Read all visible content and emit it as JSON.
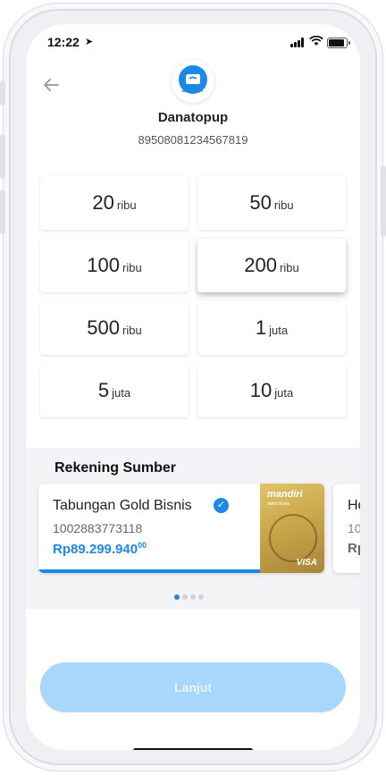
{
  "status_bar": {
    "time": "12:22",
    "location_glyph": "➤"
  },
  "header": {
    "back_glyph": "←",
    "logo_text": "DANA",
    "merchant_name": "Danatopup",
    "phone_number": "89508081234567819"
  },
  "amounts": [
    {
      "num": "20",
      "unit": "ribu"
    },
    {
      "num": "50",
      "unit": "ribu"
    },
    {
      "num": "100",
      "unit": "ribu"
    },
    {
      "num": "200",
      "unit": "ribu",
      "selected": true
    },
    {
      "num": "500",
      "unit": "ribu"
    },
    {
      "num": "1",
      "unit": "juta"
    },
    {
      "num": "5",
      "unit": "juta"
    },
    {
      "num": "10",
      "unit": "juta"
    }
  ],
  "source": {
    "title": "Rekening Sumber",
    "card": {
      "name": "Tabungan Gold Bisnis",
      "account": "1002883773118",
      "balance": "Rp89.299.940",
      "balance_cents": "00",
      "bank_logo": "mandiri",
      "bank_sub": "debit bisnis",
      "network": "VISA"
    },
    "next_card": {
      "name": "Ho",
      "account": "10",
      "balance": "Rp"
    },
    "pager": {
      "count": 4,
      "active": 0
    }
  },
  "footer": {
    "button_label": "Lanjut"
  },
  "colors": {
    "accent": "#1e88e5",
    "button_disabled": "#a9d6fb"
  }
}
